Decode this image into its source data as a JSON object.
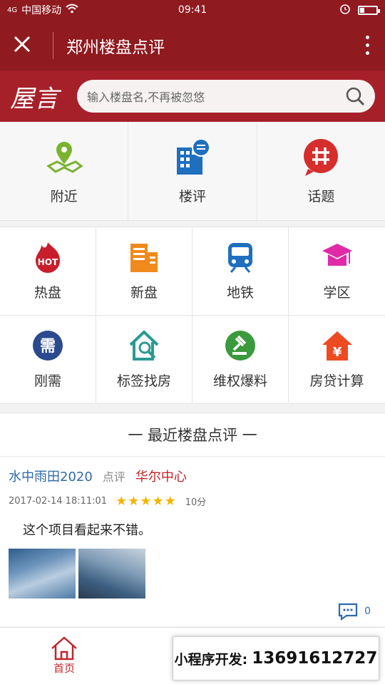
{
  "statusbar": {
    "carrier": "中国移动",
    "signal": "4G",
    "time": "09:41"
  },
  "header": {
    "title": "郑州楼盘点评"
  },
  "search": {
    "logo": "屋言",
    "placeholder": "输入楼盘名,不再被忽悠"
  },
  "top_nav": [
    {
      "label": "附近",
      "icon": "map-pin-icon"
    },
    {
      "label": "楼评",
      "icon": "building-comment-icon"
    },
    {
      "label": "话题",
      "icon": "hashtag-icon"
    }
  ],
  "grid": [
    {
      "label": "热盘",
      "icon": "hot-icon",
      "badge": "HOT"
    },
    {
      "label": "新盘",
      "icon": "new-building-icon"
    },
    {
      "label": "地铁",
      "icon": "subway-icon"
    },
    {
      "label": "学区",
      "icon": "graduation-cap-icon"
    },
    {
      "label": "刚需",
      "icon": "need-icon",
      "badge": "需"
    },
    {
      "label": "标签找房",
      "icon": "house-search-icon"
    },
    {
      "label": "维权爆料",
      "icon": "gavel-icon"
    },
    {
      "label": "房贷计算",
      "icon": "loan-house-icon",
      "badge": "¥"
    }
  ],
  "section": {
    "title": "一 最近楼盘点评 一"
  },
  "review": {
    "user": "水中雨田2020",
    "tag": "点评",
    "project": "华尔中心",
    "datetime": "2017-02-14 18:11:01",
    "stars": "★★★★★",
    "score": "10分",
    "text": "这个项目看起来不错。",
    "comment_count": "0"
  },
  "tabbar": {
    "home": "首页"
  },
  "promo": {
    "label": "小程序开发:",
    "phone": "13691612727"
  },
  "colors": {
    "brand": "#8f1a1f",
    "accent": "#c0262c",
    "link": "#2e6aa8",
    "star": "#f5b400"
  }
}
